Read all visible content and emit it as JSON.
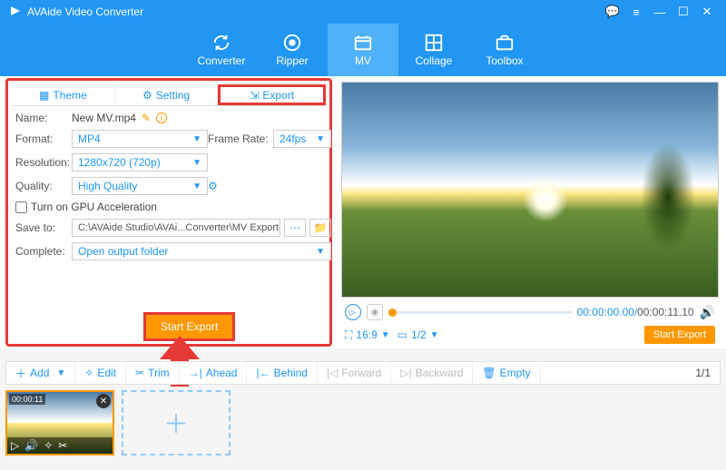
{
  "app_title": "AVAide Video Converter",
  "main_tabs": {
    "converter": "Converter",
    "ripper": "Ripper",
    "mv": "MV",
    "collage": "Collage",
    "toolbox": "Toolbox"
  },
  "panel_tabs": {
    "theme": "Theme",
    "setting": "Setting",
    "export": "Export"
  },
  "form": {
    "name_label": "Name:",
    "name_value": "New MV.mp4",
    "format_label": "Format:",
    "format_value": "MP4",
    "framerate_label": "Frame Rate:",
    "framerate_value": "24fps",
    "resolution_label": "Resolution:",
    "resolution_value": "1280x720 (720p)",
    "quality_label": "Quality:",
    "quality_value": "High Quality",
    "gpu_label": "Turn on GPU Acceleration",
    "saveto_label": "Save to:",
    "saveto_path": "C:\\AVAide Studio\\AVAi...Converter\\MV Exported",
    "complete_label": "Complete:",
    "complete_value": "Open output folder"
  },
  "player": {
    "current": "00:00:00.00",
    "duration": "00:00:11.10",
    "ratio": "16:9",
    "page": "1/2"
  },
  "buttons": {
    "start_export": "Start Export",
    "start_export_mini": "Start Export"
  },
  "toolbar": {
    "add": "Add",
    "edit": "Edit",
    "trim": "Trim",
    "ahead": "Ahead",
    "behind": "Behind",
    "forward": "Forward",
    "backward": "Backward",
    "empty": "Empty",
    "page": "1/1"
  },
  "thumb": {
    "duration": "00:00:11"
  }
}
